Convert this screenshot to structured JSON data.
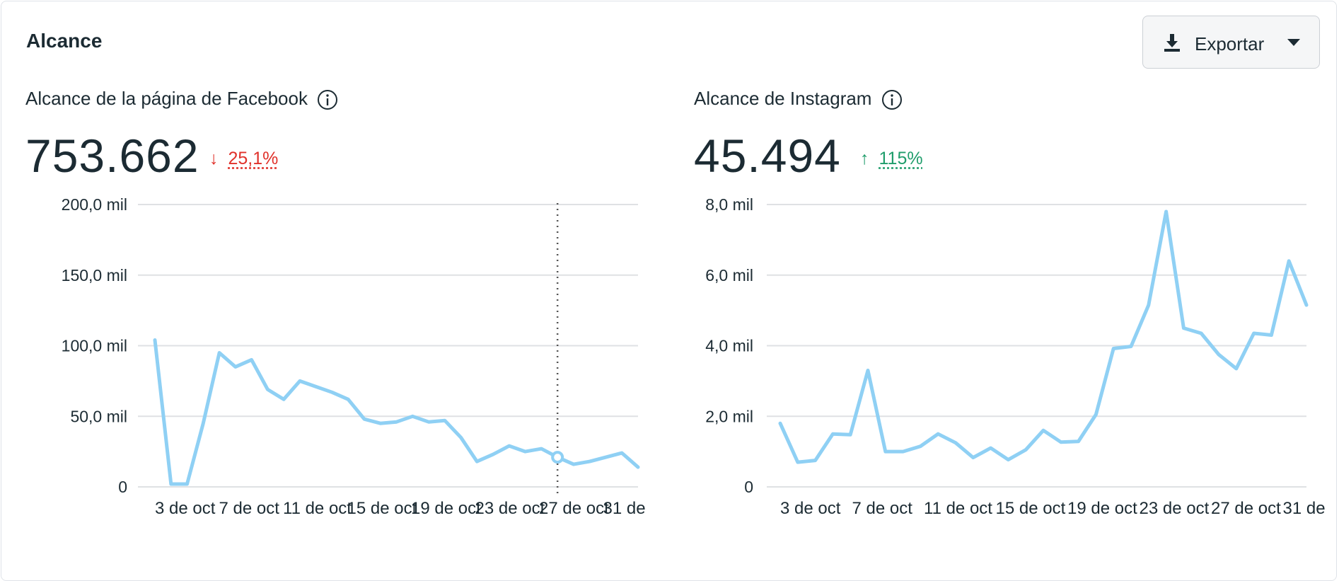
{
  "header": {
    "title": "Alcance",
    "export_label": "Exportar"
  },
  "icons": {
    "export": "download-icon",
    "caret": "chevron-down-icon",
    "info": "info-icon"
  },
  "colors": {
    "line": "#8fd0f4",
    "grid": "#dfe1e4",
    "down": "#e0312a",
    "up": "#1f9d6b"
  },
  "panels": [
    {
      "title": "Alcance de la página de Facebook",
      "value": "753.662",
      "delta": "25,1%",
      "direction": "down"
    },
    {
      "title": "Alcance de Instagram",
      "value": "45.494",
      "delta": "115%",
      "direction": "up"
    }
  ],
  "chart_data": [
    {
      "type": "line",
      "title": "Alcance de la página de Facebook",
      "y_tick_labels": [
        "0",
        "50,0 mil",
        "100,0 mil",
        "150,0 mil",
        "200,0 mil"
      ],
      "ylim": [
        0,
        200000
      ],
      "x_tick_labels": [
        "3 de oct",
        "7 de oct",
        "11 de oct",
        "15 de oct",
        "19 de oct",
        "23 de oct",
        "27 de oct",
        "31 de"
      ],
      "grid": true,
      "hover_index": 25,
      "series": [
        {
          "values": [
            104000,
            2000,
            2000,
            45000,
            95000,
            85000,
            90000,
            69000,
            62000,
            75000,
            71000,
            67000,
            62000,
            48000,
            45000,
            46000,
            50000,
            46000,
            47000,
            35000,
            18000,
            23000,
            29000,
            25000,
            27000,
            21000,
            16000,
            18000,
            21000,
            24000,
            14000
          ]
        }
      ]
    },
    {
      "type": "line",
      "title": "Alcance de Instagram",
      "y_tick_labels": [
        "0",
        "2,0 mil",
        "4,0 mil",
        "6,0 mil",
        "8,0 mil"
      ],
      "ylim": [
        0,
        8000
      ],
      "x_tick_labels": [
        "3 de oct",
        "7 de oct",
        "11 de oct",
        "15 de oct",
        "19 de oct",
        "23 de oct",
        "27 de oct",
        "31 de"
      ],
      "grid": true,
      "series": [
        {
          "values": [
            1800,
            700,
            750,
            1500,
            1480,
            3300,
            1000,
            1000,
            1150,
            1500,
            1250,
            830,
            1100,
            770,
            1050,
            1600,
            1270,
            1290,
            2050,
            3920,
            3980,
            5150,
            7800,
            4500,
            4350,
            3750,
            3350,
            4350,
            4300,
            6400,
            5150
          ]
        }
      ]
    }
  ]
}
